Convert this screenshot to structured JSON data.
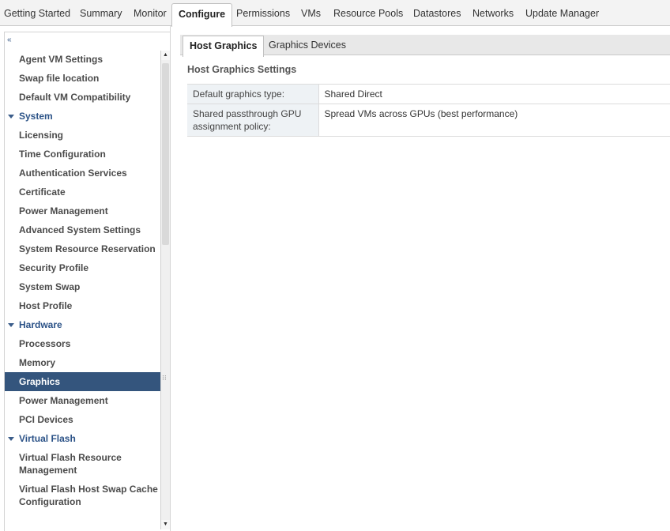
{
  "top_tabs": [
    {
      "label": "Getting Started"
    },
    {
      "label": "Summary"
    },
    {
      "label": "Monitor"
    },
    {
      "label": "Configure"
    },
    {
      "label": "Permissions"
    },
    {
      "label": "VMs"
    },
    {
      "label": "Resource Pools"
    },
    {
      "label": "Datastores"
    },
    {
      "label": "Networks"
    },
    {
      "label": "Update Manager"
    }
  ],
  "nav": {
    "collapse_glyph": "«",
    "items": [
      {
        "label": "Agent VM Settings"
      },
      {
        "label": "Swap file location"
      },
      {
        "label": "Default VM Compatibility"
      }
    ],
    "system": {
      "label": "System",
      "items": [
        {
          "label": "Licensing"
        },
        {
          "label": "Time Configuration"
        },
        {
          "label": "Authentication Services"
        },
        {
          "label": "Certificate"
        },
        {
          "label": "Power Management"
        },
        {
          "label": "Advanced System Settings"
        },
        {
          "label": "System Resource Reservation"
        },
        {
          "label": "Security Profile"
        },
        {
          "label": "System Swap"
        },
        {
          "label": "Host Profile"
        }
      ]
    },
    "hardware": {
      "label": "Hardware",
      "items": [
        {
          "label": "Processors"
        },
        {
          "label": "Memory"
        },
        {
          "label": "Graphics"
        },
        {
          "label": "Power Management"
        },
        {
          "label": "PCI Devices"
        }
      ]
    },
    "virtual_flash": {
      "label": "Virtual Flash",
      "items": [
        {
          "label": "Virtual Flash Resource Management"
        },
        {
          "label": "Virtual Flash Host Swap Cache Configuration"
        }
      ]
    }
  },
  "sub_tabs": [
    {
      "label": "Host Graphics"
    },
    {
      "label": "Graphics Devices"
    }
  ],
  "panel": {
    "title": "Host Graphics Settings",
    "rows": [
      {
        "key": "Default graphics type:",
        "value": "Shared Direct"
      },
      {
        "key": "Shared passthrough GPU assignment policy:",
        "value": "Spread VMs across GPUs (best performance)"
      }
    ]
  },
  "colors": {
    "selected_bg": "#34557d",
    "section_text": "#2b5287"
  }
}
